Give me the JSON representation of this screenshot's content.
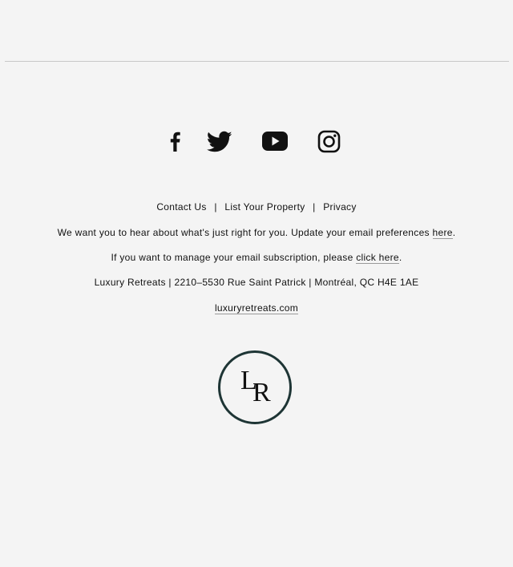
{
  "social": {
    "items": [
      {
        "name": "facebook",
        "icon": "facebook-icon"
      },
      {
        "name": "twitter",
        "icon": "twitter-icon"
      },
      {
        "name": "youtube",
        "icon": "youtube-icon"
      },
      {
        "name": "instagram",
        "icon": "instagram-icon"
      }
    ]
  },
  "footer_links": {
    "contact": "Contact Us",
    "list_property": "List Your Property",
    "privacy": "Privacy",
    "separator": "|"
  },
  "preferences": {
    "text": "We want you to hear about what's just right for you. Update your email preferences ",
    "link": "here",
    "end": "."
  },
  "subscription": {
    "text": "If you want to manage your email subscription, please ",
    "link": "click here",
    "end": "."
  },
  "address": "Luxury Retreats | 2210–5530 Rue Saint Patrick | Montréal, QC H4E 1AE",
  "website": "luxuryretreats.com",
  "logo": {
    "letter_1": "L",
    "letter_2": "R",
    "ring_color": "#1e3535"
  },
  "colors": {
    "background": "#f4f4f4",
    "text": "#111111",
    "divider": "#c8c8c8"
  }
}
